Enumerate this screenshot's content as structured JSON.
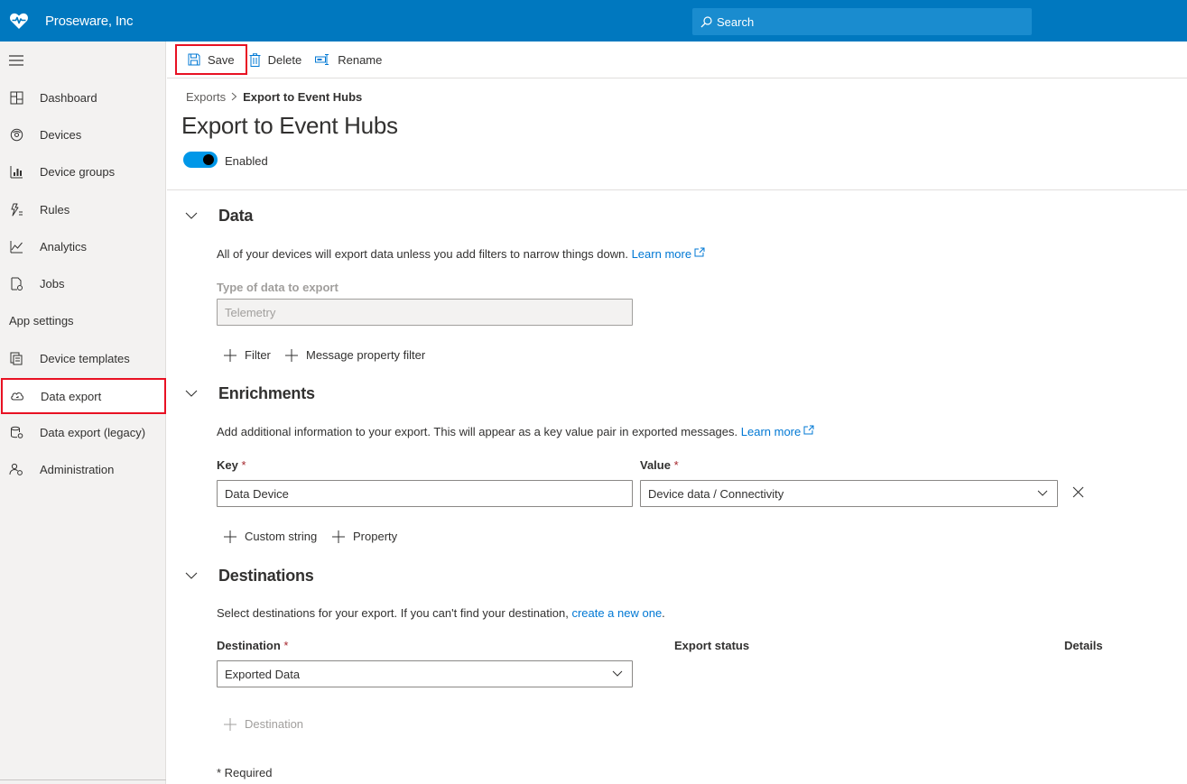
{
  "app": {
    "name": "Proseware, Inc",
    "search_placeholder": "Search"
  },
  "sidebar": {
    "items": [
      {
        "label": "Dashboard",
        "icon": "dashboard-icon"
      },
      {
        "label": "Devices",
        "icon": "devices-icon"
      },
      {
        "label": "Device groups",
        "icon": "device-groups-icon"
      },
      {
        "label": "Rules",
        "icon": "rules-icon"
      },
      {
        "label": "Analytics",
        "icon": "analytics-icon"
      },
      {
        "label": "Jobs",
        "icon": "jobs-icon"
      }
    ],
    "section_label": "App settings",
    "settings_items": [
      {
        "label": "Device templates",
        "icon": "device-templates-icon"
      },
      {
        "label": "Data export",
        "icon": "data-export-icon",
        "active": true
      },
      {
        "label": "Data export (legacy)",
        "icon": "data-export-legacy-icon"
      },
      {
        "label": "Administration",
        "icon": "administration-icon"
      }
    ]
  },
  "toolbar": {
    "save_label": "Save",
    "delete_label": "Delete",
    "rename_label": "Rename"
  },
  "breadcrumb": {
    "parent": "Exports",
    "current": "Export to Event Hubs"
  },
  "page": {
    "title": "Export to Event Hubs",
    "toggle_label": "Enabled",
    "toggle_on": true
  },
  "data_section": {
    "title": "Data",
    "description": "All of your devices will export data unless you add filters to narrow things down.",
    "learn_more": "Learn more",
    "type_label": "Type of data to export",
    "type_value": "Telemetry",
    "filter_label": "Filter",
    "message_filter_label": "Message property filter"
  },
  "enrichments_section": {
    "title": "Enrichments",
    "description": "Add additional information to your export. This will appear as a key value pair in exported messages.",
    "learn_more": "Learn more",
    "key_label": "Key",
    "value_label": "Value",
    "key_value": "Data Device",
    "value_value": "Device data / Connectivity",
    "custom_string_label": "Custom string",
    "property_label": "Property"
  },
  "destinations_section": {
    "title": "Destinations",
    "description": "Select destinations for your export. If you can't find your destination,",
    "create_link": "create a new one",
    "period": ".",
    "destination_label": "Destination",
    "export_status_label": "Export status",
    "details_label": "Details",
    "destination_value": "Exported Data",
    "add_destination_label": "Destination"
  },
  "required_mark": "*",
  "required_note": "* Required",
  "colors": {
    "brand": "#0078bf",
    "accent": "#0078d4",
    "toggle": "#0097e8",
    "highlight": "#e81123"
  }
}
